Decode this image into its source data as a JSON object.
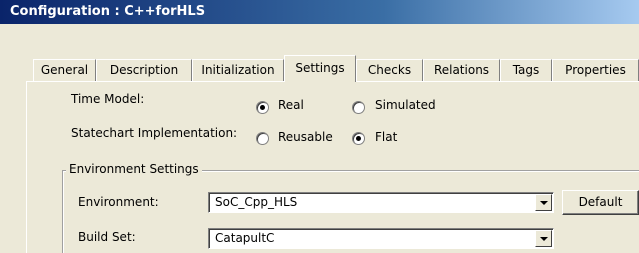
{
  "window": {
    "title": "Configuration : C++forHLS"
  },
  "tabs": [
    {
      "label": "General",
      "active": false
    },
    {
      "label": "Description",
      "active": false
    },
    {
      "label": "Initialization",
      "active": false
    },
    {
      "label": "Settings",
      "active": true
    },
    {
      "label": "Checks",
      "active": false
    },
    {
      "label": "Relations",
      "active": false
    },
    {
      "label": "Tags",
      "active": false
    },
    {
      "label": "Properties",
      "active": false
    }
  ],
  "settings": {
    "time_model": {
      "label": "Time Model:",
      "options": [
        {
          "label": "Real",
          "selected": true
        },
        {
          "label": "Simulated",
          "selected": false
        }
      ]
    },
    "statechart": {
      "label": "Statechart Implementation:",
      "options": [
        {
          "label": "Reusable",
          "selected": false
        },
        {
          "label": "Flat",
          "selected": true
        }
      ]
    }
  },
  "environment_settings": {
    "legend": "Environment Settings",
    "environment": {
      "label": "Environment:",
      "value": "SoC_Cpp_HLS"
    },
    "default_button": "Default",
    "build_set": {
      "label": "Build Set:",
      "value": "CatapultC"
    }
  }
}
